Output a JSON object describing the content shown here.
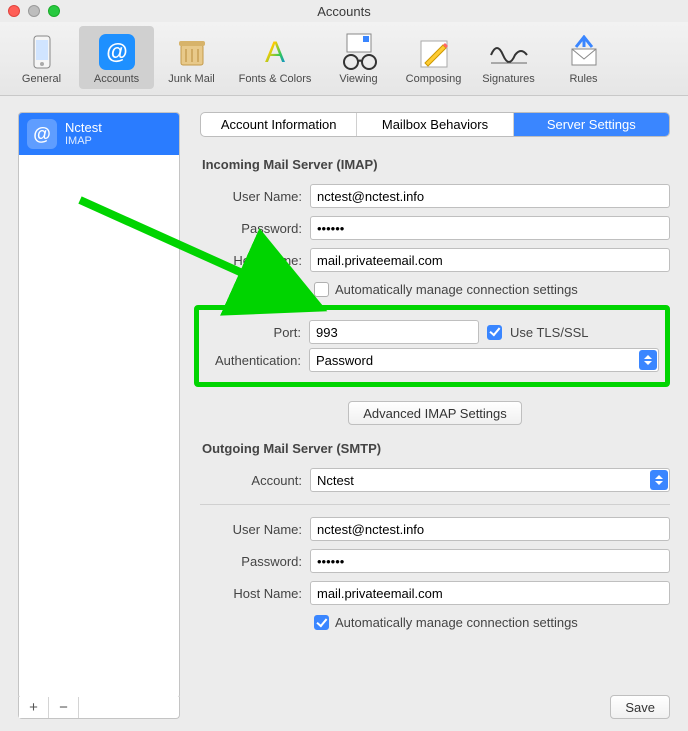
{
  "window": {
    "title": "Accounts"
  },
  "toolbar": {
    "items": [
      {
        "label": "General"
      },
      {
        "label": "Accounts"
      },
      {
        "label": "Junk Mail"
      },
      {
        "label": "Fonts & Colors"
      },
      {
        "label": "Viewing"
      },
      {
        "label": "Composing"
      },
      {
        "label": "Signatures"
      },
      {
        "label": "Rules"
      }
    ]
  },
  "sidebar": {
    "account": {
      "name": "Nctest",
      "protocol": "IMAP"
    }
  },
  "tabs": {
    "items": [
      {
        "label": "Account Information"
      },
      {
        "label": "Mailbox Behaviors"
      },
      {
        "label": "Server Settings"
      }
    ]
  },
  "incoming": {
    "title": "Incoming Mail Server (IMAP)",
    "labels": {
      "username": "User Name:",
      "password": "Password:",
      "hostname": "Host Name:",
      "port": "Port:",
      "auth": "Authentication:",
      "auto": "Automatically manage connection settings",
      "tls": "Use TLS/SSL"
    },
    "values": {
      "username": "nctest@nctest.info",
      "password": "••••••",
      "hostname": "mail.privateemail.com",
      "port": "993",
      "auth": "Password",
      "auto_checked": false,
      "tls_checked": true
    },
    "advanced_button": "Advanced IMAP Settings"
  },
  "outgoing": {
    "title": "Outgoing Mail Server (SMTP)",
    "labels": {
      "account": "Account:",
      "username": "User Name:",
      "password": "Password:",
      "hostname": "Host Name:",
      "auto": "Automatically manage connection settings"
    },
    "values": {
      "account": "Nctest",
      "username": "nctest@nctest.info",
      "password": "••••••",
      "hostname": "mail.privateemail.com",
      "auto_checked": true
    }
  },
  "footer": {
    "save": "Save"
  }
}
